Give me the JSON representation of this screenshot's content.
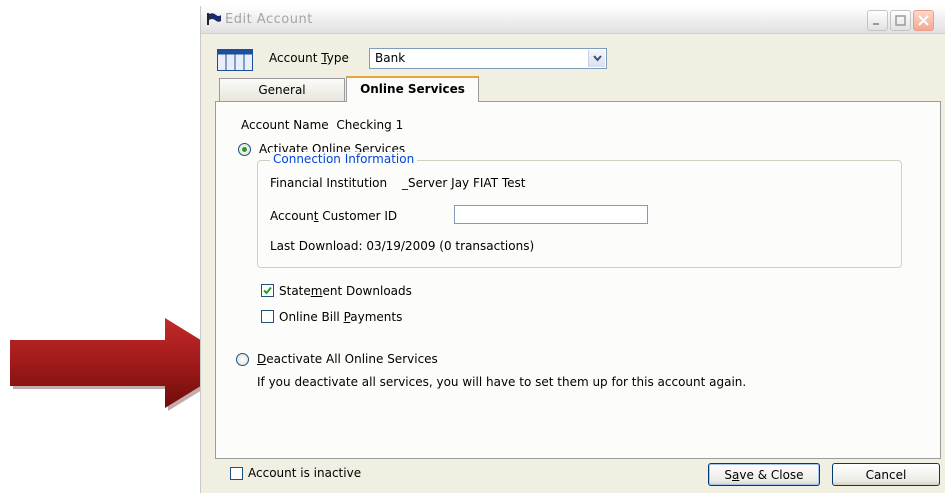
{
  "window": {
    "title": "Edit Account"
  },
  "account_type": {
    "label_pre": "Account ",
    "label_key": "T",
    "label_post": "ype",
    "value": "Bank"
  },
  "tabs": [
    {
      "label": "General",
      "selected": false
    },
    {
      "label": "Online Services",
      "selected": true
    }
  ],
  "online_services": {
    "account_name_label": "Account Name",
    "account_name_value": "Checking 1",
    "activate": {
      "pre": "Activate Online ",
      "key": "S",
      "post": "ervices",
      "selected": true
    },
    "connection": {
      "legend": "Connection Information",
      "institution_label": "Financial Institution",
      "institution_value": "_Server Jay FIAT Test",
      "customer_id_pre": "Accoun",
      "customer_id_key": "t",
      "customer_id_post": " Customer ID",
      "customer_id_value": "",
      "last_download": "Last Download: 03/19/2009 (0 transactions)"
    },
    "statement_downloads": {
      "pre": "State",
      "key": "m",
      "post": "ent Downloads",
      "checked": true
    },
    "bill_payments": {
      "pre": "Online Bill ",
      "key": "P",
      "post": "ayments",
      "checked": false
    },
    "deactivate": {
      "key": "D",
      "post": "eactivate All Online Services",
      "selected": false,
      "note": "If you deactivate all services, you will have to set them up for this account again."
    }
  },
  "footer": {
    "inactive_label": "Account is inactive",
    "inactive_checked": false,
    "save_pre": "S",
    "save_key": "a",
    "save_post": "ve & Close",
    "cancel_label": "Cancel"
  },
  "colors": {
    "accent_tab": "#e8a33b",
    "legend": "#0046d5",
    "arrow": "#a11a1a"
  }
}
